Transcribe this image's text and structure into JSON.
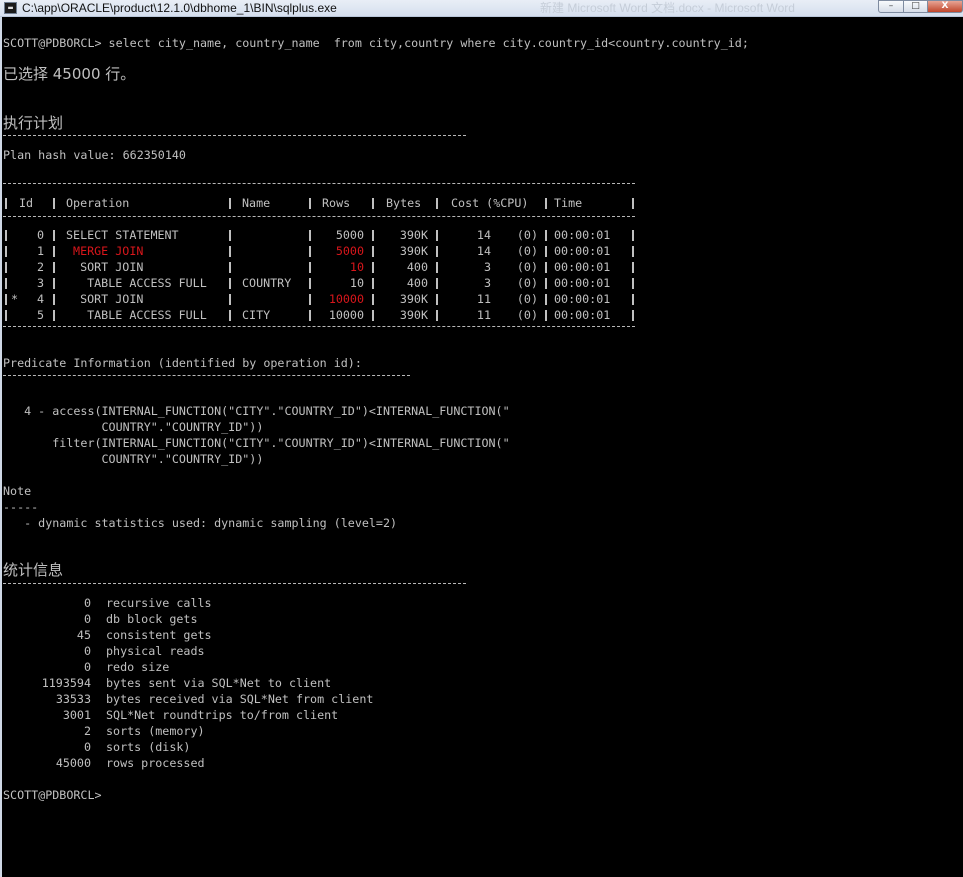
{
  "window": {
    "title": "C:\\app\\ORACLE\\product\\12.1.0\\dbhome_1\\BIN\\sqlplus.exe",
    "background_title": "新建 Microsoft Word 文档.docx - Microsoft Word",
    "minimize": "–",
    "maximize": "□",
    "close": "X"
  },
  "console": {
    "prompt_query": "SCOTT@PDBORCL> select city_name, country_name  from city,country where city.country_id<country.country_id;",
    "rows_selected": "已选择 45000 行。",
    "exec_plan_heading": "执行计划",
    "plan_hash": "Plan hash value: 662350140",
    "plan_table": {
      "headers": [
        "Id",
        "Operation",
        "Name",
        "Rows",
        "Bytes",
        "Cost (%CPU)",
        "Time"
      ],
      "rows": [
        {
          "star": "",
          "id": "0",
          "operation": "SELECT STATEMENT",
          "name": "",
          "rows": "5000",
          "bytes": "390K",
          "cost": "14",
          "cpu": "(0)",
          "time": "00:00:01",
          "highlight": false
        },
        {
          "star": "",
          "id": "1",
          "operation": " MERGE JOIN",
          "name": "",
          "rows": "5000",
          "bytes": "390K",
          "cost": "14",
          "cpu": "(0)",
          "time": "00:00:01",
          "highlight": true
        },
        {
          "star": "",
          "id": "2",
          "operation": "  SORT JOIN",
          "name": "",
          "rows": "10",
          "bytes": "400",
          "cost": "3",
          "cpu": "(0)",
          "time": "00:00:01",
          "highlight": false,
          "rows_red": true
        },
        {
          "star": "",
          "id": "3",
          "operation": "   TABLE ACCESS FULL",
          "name": "COUNTRY",
          "rows": "10",
          "bytes": "400",
          "cost": "3",
          "cpu": "(0)",
          "time": "00:00:01",
          "highlight": false
        },
        {
          "star": "*",
          "id": "4",
          "operation": "  SORT JOIN",
          "name": "",
          "rows": "10000",
          "bytes": "390K",
          "cost": "11",
          "cpu": "(0)",
          "time": "00:00:01",
          "highlight": false,
          "rows_red": true
        },
        {
          "star": "",
          "id": "5",
          "operation": "   TABLE ACCESS FULL",
          "name": "CITY",
          "rows": "10000",
          "bytes": "390K",
          "cost": "11",
          "cpu": "(0)",
          "time": "00:00:01",
          "highlight": false
        }
      ]
    },
    "predicate_heading": "Predicate Information (identified by operation id):",
    "predicate_lines": [
      "   4 - access(INTERNAL_FUNCTION(\"CITY\".\"COUNTRY_ID\")<INTERNAL_FUNCTION(\"",
      "              COUNTRY\".\"COUNTRY_ID\"))",
      "       filter(INTERNAL_FUNCTION(\"CITY\".\"COUNTRY_ID\")<INTERNAL_FUNCTION(\"",
      "              COUNTRY\".\"COUNTRY_ID\"))"
    ],
    "note_heading": "Note",
    "note_rule": "-----",
    "note_line": "   - dynamic statistics used: dynamic sampling (level=2)",
    "stats_heading": "统计信息",
    "stats": [
      {
        "value": "0",
        "label": "recursive calls"
      },
      {
        "value": "0",
        "label": "db block gets"
      },
      {
        "value": "45",
        "label": "consistent gets"
      },
      {
        "value": "0",
        "label": "physical reads"
      },
      {
        "value": "0",
        "label": "redo size"
      },
      {
        "value": "1193594",
        "label": "bytes sent via SQL*Net to client"
      },
      {
        "value": "33533",
        "label": "bytes received via SQL*Net from client"
      },
      {
        "value": "3001",
        "label": "SQL*Net roundtrips to/from client"
      },
      {
        "value": "2",
        "label": "sorts (memory)"
      },
      {
        "value": "0",
        "label": "sorts (disk)"
      },
      {
        "value": "45000",
        "label": "rows processed"
      }
    ],
    "final_prompt": "SCOTT@PDBORCL>"
  },
  "colors": {
    "console_bg": "#000000",
    "console_fg": "#c0c0c0",
    "highlight_red": "#d8161b"
  }
}
